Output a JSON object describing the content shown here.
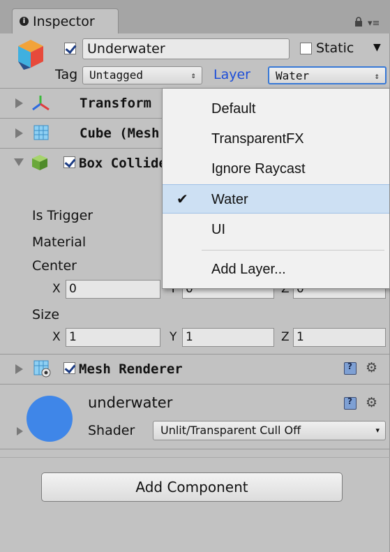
{
  "tab": {
    "title": "Inspector"
  },
  "header": {
    "object_name": "Underwater",
    "active": true,
    "static_label": "Static",
    "tag_label": "Tag",
    "tag_value": "Untagged",
    "layer_label": "Layer",
    "layer_value": "Water"
  },
  "components": {
    "transform": {
      "title": "Transform"
    },
    "mesh_filter": {
      "title": "Cube (Mesh Filter)"
    },
    "box_collider": {
      "title": "Box Collider",
      "enabled": true,
      "is_trigger_label": "Is Trigger",
      "material_label": "Material",
      "center_label": "Center",
      "center": {
        "x": "0",
        "y": "0",
        "z": "0"
      },
      "size_label": "Size",
      "size": {
        "x": "1",
        "y": "1",
        "z": "1"
      }
    },
    "mesh_renderer": {
      "title": "Mesh Renderer",
      "enabled": true
    },
    "material": {
      "name": "underwater",
      "shader_label": "Shader",
      "shader_value": "Unlit/Transparent Cull Off",
      "color": "#3f86e8"
    }
  },
  "axes": {
    "x": "X",
    "y": "Y",
    "z": "Z"
  },
  "add_component_label": "Add Component",
  "layer_menu": {
    "items": [
      {
        "label": "Default",
        "selected": false
      },
      {
        "label": "TransparentFX",
        "selected": false
      },
      {
        "label": "Ignore Raycast",
        "selected": false
      },
      {
        "label": "Water",
        "selected": true
      },
      {
        "label": "UI",
        "selected": false
      }
    ],
    "add_layer": "Add Layer...",
    "check_glyph": "✔"
  },
  "colors": {
    "panel": "#c2c2c2",
    "accent": "#1d4ed8",
    "menu_selected": "#cde0f3"
  },
  "icons": {
    "arrows": "⇕",
    "dropdown_arrow": "▼",
    "small_arrow": "▾",
    "gear": "⚙",
    "menu": "▾≡"
  }
}
